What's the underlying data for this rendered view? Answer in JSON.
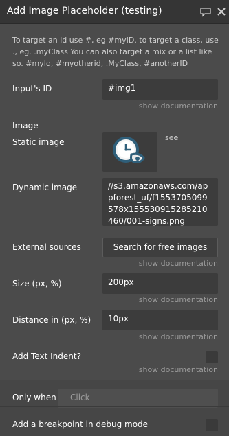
{
  "header": {
    "title": "Add Image Placeholder (testing)",
    "icons": [
      "comment-icon",
      "close-icon"
    ]
  },
  "hint": "To target an id use #, eg #myID. to target a class, use ., eg. .myClass You can also target a mix or a list like so. #myId, #myotherid, .MyClass, #anotherID",
  "inputs_id": {
    "label": "Input's ID",
    "value": "#img1",
    "doc": "show documentation"
  },
  "image": {
    "section_label": "Image",
    "static_label": "Static image",
    "see_label": "see",
    "dynamic_label": "Dynamic image",
    "dynamic_value": "//s3.amazonaws.com/appforest_uf/f1553705099578x155530915285210460/001-signs.png"
  },
  "external": {
    "label": "External sources",
    "button": "Search for free images",
    "doc": "show documentation"
  },
  "size": {
    "label": "Size (px, %)",
    "value": "200px",
    "doc": "show documentation"
  },
  "distance": {
    "label": "Distance in (px, %)",
    "value": "10px",
    "doc": "show documentation"
  },
  "indent": {
    "label": "Add Text Indent?",
    "doc": "show documentation"
  },
  "only_when": {
    "label": "Only when",
    "placeholder": "Click"
  },
  "breakpoint": {
    "label": "Add a breakpoint in debug mode"
  },
  "colors": {
    "header_bg": "#353535",
    "panel_bg": "#4b4b4b",
    "field_bg": "#3c3c3c"
  }
}
